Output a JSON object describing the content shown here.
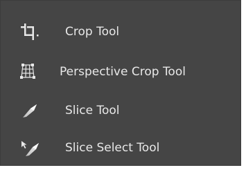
{
  "menu": {
    "items": [
      {
        "label": "Crop Tool",
        "icon": "crop-icon"
      },
      {
        "label": "Perspective Crop Tool",
        "icon": "perspective-crop-icon"
      },
      {
        "label": "Slice Tool",
        "icon": "slice-icon"
      },
      {
        "label": "Slice Select Tool",
        "icon": "slice-select-icon"
      }
    ]
  },
  "colors": {
    "menu_background": "#454545",
    "label_text": "#e8e8e8",
    "icon": "#e8e8e8"
  }
}
